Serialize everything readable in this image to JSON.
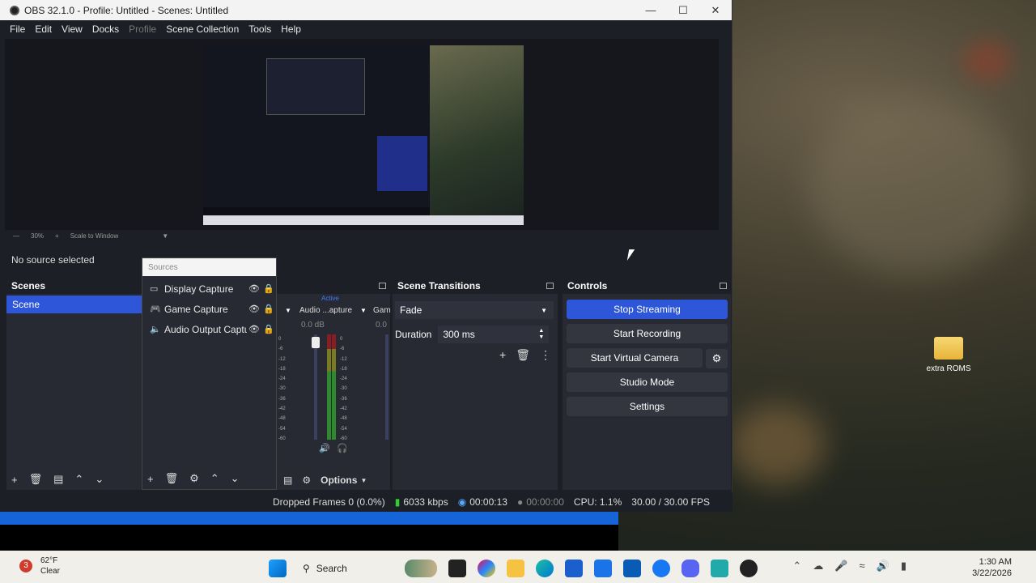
{
  "window": {
    "title": "OBS 32.1.0 - Profile: Untitled - Scenes: Untitled"
  },
  "menu": [
    "File",
    "Edit",
    "View",
    "Docks",
    "Profile",
    "Scene Collection",
    "Tools",
    "Help"
  ],
  "preview": {
    "zoom_label": "30%",
    "scale_label": "Scale to Window"
  },
  "context": {
    "no_source": "No source selected"
  },
  "scenes": {
    "title": "Scenes",
    "items": [
      "Scene"
    ]
  },
  "sources": {
    "title": "Sources",
    "items": [
      {
        "name": "Display Capture",
        "icon": "monitor-icon"
      },
      {
        "name": "Game Capture",
        "icon": "gamepad-icon"
      },
      {
        "name": "Audio Output Capture",
        "icon": "speaker-icon"
      }
    ]
  },
  "mixer": {
    "active_label": "Active",
    "channel_name": "Audio ...apture",
    "channel2_name": "Gam",
    "db": "0.0 dB",
    "db2": "0.0",
    "scale": [
      "0",
      "-6",
      "-12",
      "-18",
      "-24",
      "-30",
      "-36",
      "-42",
      "-48",
      "-54",
      "-60"
    ],
    "options_label": "Options"
  },
  "transitions": {
    "title": "Scene Transitions",
    "selected": "Fade",
    "duration_label": "Duration",
    "duration_value": "300 ms"
  },
  "controls": {
    "title": "Controls",
    "stop_streaming": "Stop Streaming",
    "start_recording": "Start Recording",
    "start_virtual_camera": "Start Virtual Camera",
    "studio_mode": "Studio Mode",
    "settings": "Settings"
  },
  "status": {
    "dropped_frames": "Dropped Frames 0 (0.0%)",
    "bitrate": "6033 kbps",
    "stream_time": "00:00:13",
    "record_time": "00:00:00",
    "cpu": "CPU: 1.1%",
    "fps": "30.00 / 30.00 FPS"
  },
  "desktop": {
    "icon_label": "extra ROMS"
  },
  "taskbar": {
    "weather_temp": "62°F",
    "weather_cond": "Clear",
    "weather_badge": "3",
    "search": "Search",
    "time": "1:30 AM",
    "date": "3/22/2026"
  },
  "colors": {
    "accent": "#2d56d8",
    "panel": "#272a33",
    "background": "#1d1f26"
  }
}
